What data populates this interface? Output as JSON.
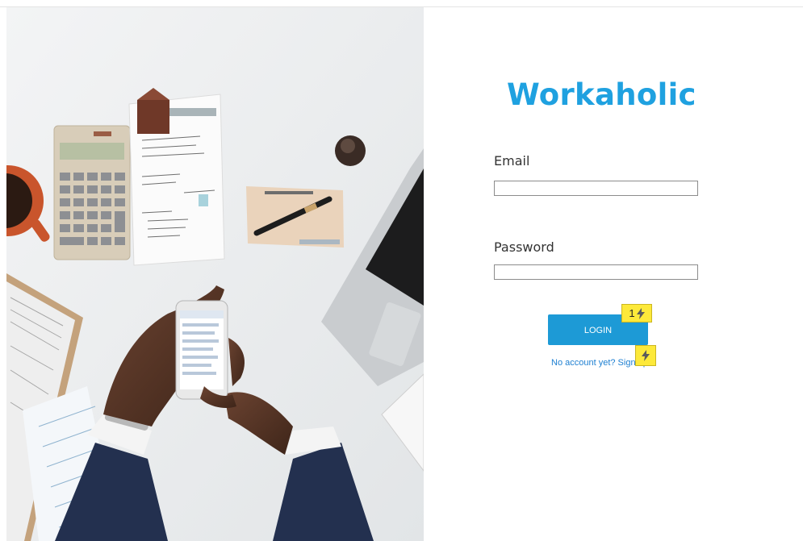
{
  "app": {
    "title": "Workaholic"
  },
  "login_form": {
    "email_label": "Email",
    "email_value": "",
    "password_label": "Password",
    "password_value": "",
    "login_button": "LOGIN",
    "signup_text": "No account yet? Sign up"
  },
  "overlay_markers": [
    {
      "label": "1",
      "icon": "lightning-icon"
    },
    {
      "label": "",
      "icon": "lightning-icon"
    }
  ],
  "colors": {
    "brand": "#1fa1e0",
    "button": "#1d9ad6",
    "link": "#1d7fd1",
    "marker": "#fde93a"
  },
  "hero_image": {
    "description_icon": "desk-photo"
  }
}
